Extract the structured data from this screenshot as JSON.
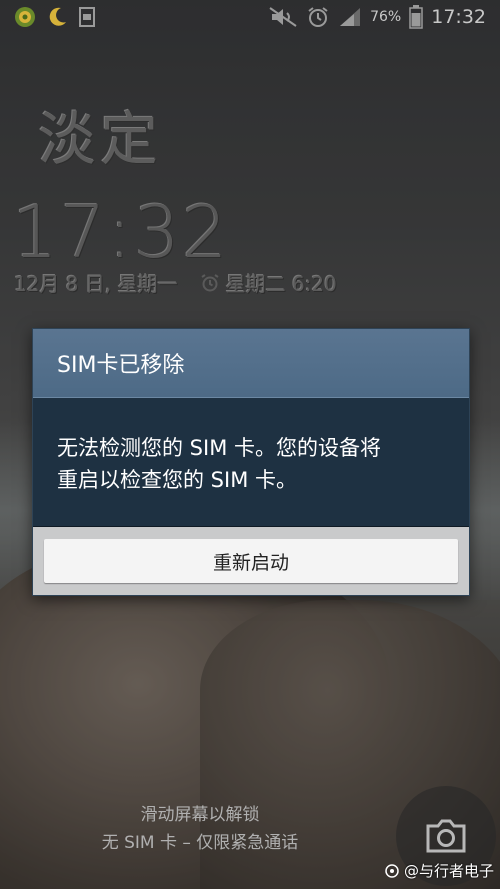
{
  "status_bar": {
    "left_icons": [
      "app-badge-icon",
      "moon-icon",
      "gallery-icon"
    ],
    "right_icons": [
      "mute-icon",
      "alarm-icon",
      "signal-icon",
      "battery-icon"
    ],
    "battery_percent": "76%",
    "time": "17:32"
  },
  "lockscreen": {
    "logo_text": "淡定",
    "time": "17:32",
    "date": "12月 8 日, 星期一",
    "alarm": "星期二 6:20"
  },
  "dialog": {
    "title": "SIM卡已移除",
    "message_line1": "无法检测您的 SIM 卡。您的设备将",
    "message_line2": "重启以检查您的 SIM 卡。",
    "button_label": "重新启动"
  },
  "footer": {
    "unlock_hint": "滑动屏幕以解锁",
    "sim_hint": "无 SIM 卡 – 仅限紧急通话",
    "watermark": "@与行者电子"
  },
  "colors": {
    "dialog_title_bg": "#5a7591",
    "dialog_body_bg": "#1e3142",
    "button_bg": "#f4f4f4"
  }
}
